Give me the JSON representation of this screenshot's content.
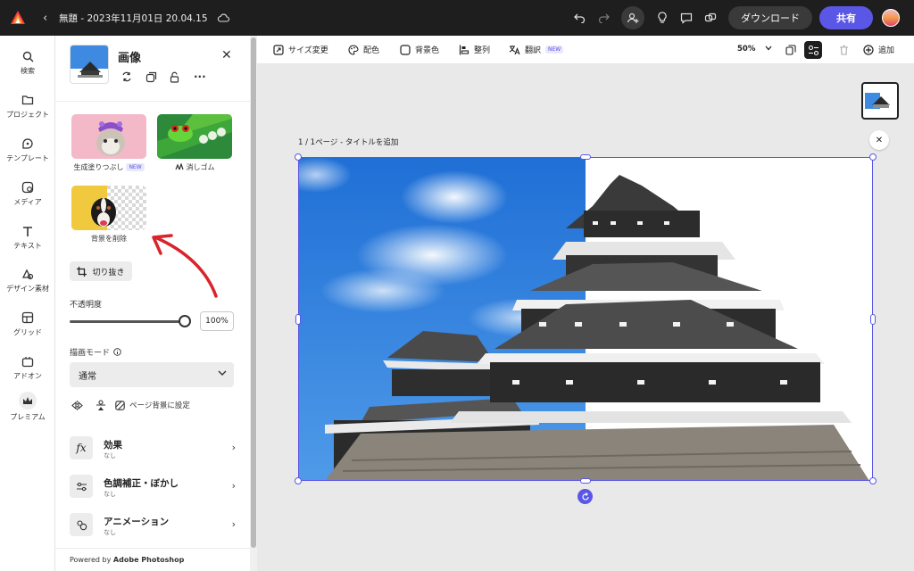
{
  "header": {
    "doc_title": "無題 - 2023年11月01日 20.04.15",
    "download_label": "ダウンロード",
    "share_label": "共有"
  },
  "rail": {
    "items": [
      {
        "label": "検索",
        "icon": "search-icon"
      },
      {
        "label": "プロジェクト",
        "icon": "folder-icon"
      },
      {
        "label": "テンプレート",
        "icon": "template-icon"
      },
      {
        "label": "メディア",
        "icon": "media-icon"
      },
      {
        "label": "テキスト",
        "icon": "text-icon"
      },
      {
        "label": "デザイン素材",
        "icon": "shapes-icon"
      },
      {
        "label": "グリッド",
        "icon": "grid-icon"
      },
      {
        "label": "アドオン",
        "icon": "addon-icon"
      },
      {
        "label": "プレミアム",
        "icon": "crown-icon"
      }
    ]
  },
  "panel": {
    "title": "画像",
    "ai_tools": [
      {
        "label": "生成塗りつぶし",
        "badge": "NEW"
      },
      {
        "label": "消しゴム"
      },
      {
        "label": "背景を削除"
      }
    ],
    "crop_label": "切り抜き",
    "opacity_label": "不透明度",
    "opacity_value": "100%",
    "opacity_level": 1.0,
    "blend_label": "描画モード",
    "blend_value": "通常",
    "set_bg_label": "ページ背景に設定",
    "sections": [
      {
        "title": "効果",
        "sub": "なし"
      },
      {
        "title": "色調補正・ぼかし",
        "sub": "なし"
      },
      {
        "title": "アニメーション",
        "sub": "なし"
      }
    ],
    "powered_prefix": "Powered by ",
    "powered_brand": "Adobe Photoshop"
  },
  "canvas_toolbar": {
    "resize": "サイズ変更",
    "color": "配色",
    "bg_color": "背景色",
    "arrange": "整列",
    "translate": "翻訳",
    "translate_badge": "NEW",
    "zoom": "50%",
    "add": "追加"
  },
  "canvas": {
    "page_label": "1 / 1ページ - タイトルを追加"
  },
  "colors": {
    "accent": "#5b57e6",
    "topbar": "#1e1e1e",
    "annotation_arrow": "#d9242b"
  }
}
